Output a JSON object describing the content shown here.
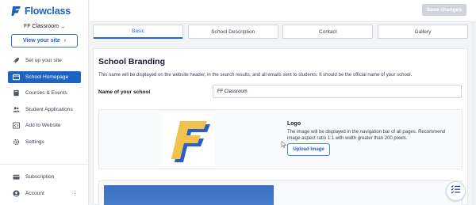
{
  "brand": {
    "name": "Flowclass",
    "color": "#1e63c4"
  },
  "school_selector": {
    "value": "FF Classroom"
  },
  "view_site_button": {
    "label": "View your site"
  },
  "nav": {
    "items": [
      {
        "label": "Set up your site",
        "icon": "rocket-icon"
      },
      {
        "label": "School Homepage",
        "icon": "homepage-icon",
        "active": true
      },
      {
        "label": "Courses & Events",
        "icon": "book-icon"
      },
      {
        "label": "Student Applications",
        "icon": "users-icon"
      },
      {
        "label": "Add to Website",
        "icon": "code-icon"
      },
      {
        "label": "Settings",
        "icon": "gear-icon"
      }
    ]
  },
  "bottom_nav": {
    "subscription": "Subscription",
    "account": "Account"
  },
  "toolbar": {
    "save_label": "Save changes"
  },
  "tabs": [
    {
      "label": "Basic",
      "active": true
    },
    {
      "label": "School Description"
    },
    {
      "label": "Contact"
    },
    {
      "label": "Gallery"
    }
  ],
  "branding": {
    "title": "School Branding",
    "description": "This name will be displayed on the website header, in the search results, and all emails sent to students. It should be the official name of your school.",
    "name_label": "Name of your school",
    "name_value": "FF Classroom"
  },
  "logo_section": {
    "title": "Logo",
    "description": "The image will be displayed in the navigation bar of all pages. Recommend image aspect ratio 1:1 with width greater than 200 pixels.",
    "upload_label": "Upload Image"
  },
  "colors": {
    "accent": "#1e63c4",
    "logo_yellow": "#f2c14e",
    "logo_blue": "#2a5fc9"
  }
}
